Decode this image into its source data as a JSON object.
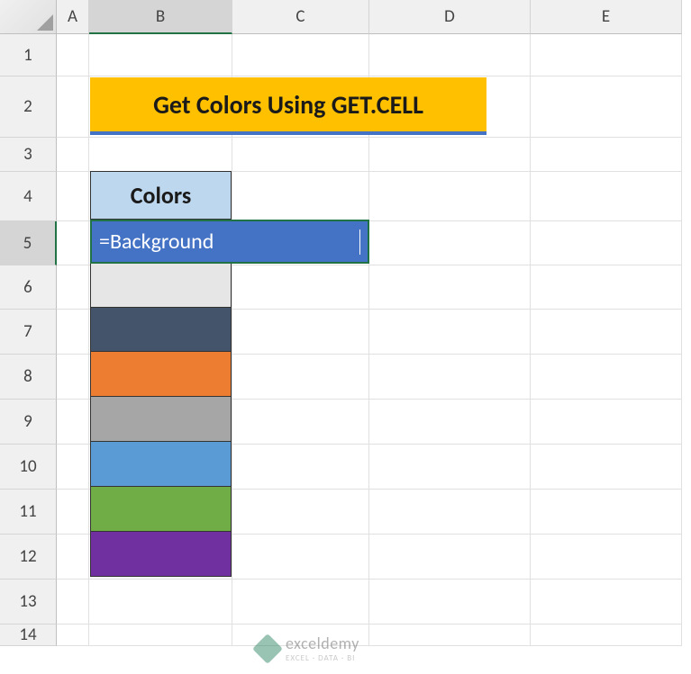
{
  "columns": [
    "A",
    "B",
    "C",
    "D",
    "E"
  ],
  "rows": [
    "1",
    "2",
    "3",
    "4",
    "5",
    "6",
    "7",
    "8",
    "9",
    "10",
    "11",
    "12",
    "13",
    "14"
  ],
  "activeCol": "B",
  "activeRow": "5",
  "title": "Get Colors Using GET.CELL",
  "tableHeader": "Colors",
  "formula": "=Background",
  "colorCells": {
    "row6": "#e7e6e6",
    "row7": "#44546a",
    "row8": "#ed7d31",
    "row9": "#a6a6a6",
    "row10": "#5b9bd5",
    "row11": "#70ad47",
    "row12": "#7030a0"
  },
  "watermark": {
    "main": "exceldemy",
    "sub": "EXCEL · DATA · BI"
  }
}
